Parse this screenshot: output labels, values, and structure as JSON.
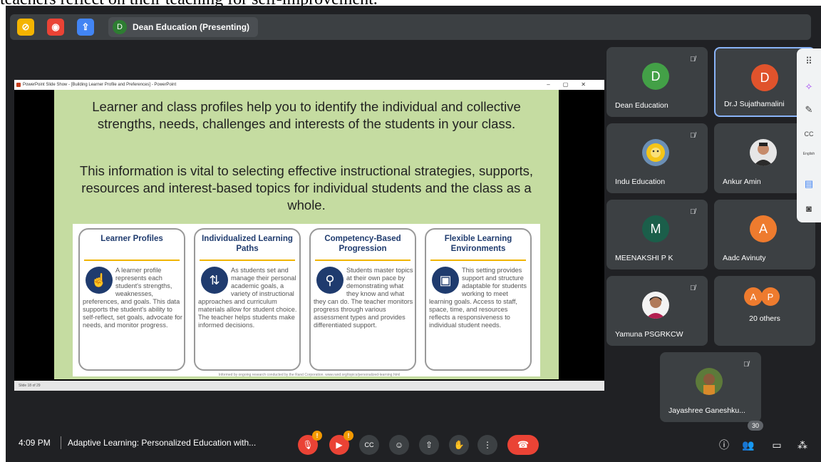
{
  "caption": "teachers reflect on their teaching for self-improvement.",
  "topbar": {
    "presenter_initial": "D",
    "presenting_label": "Dean Education (Presenting)",
    "icons": [
      "no-camera-icon",
      "record-icon",
      "share-icon"
    ],
    "colors": {
      "camera": "#f4b400",
      "record": "#ea4335",
      "share": "#4285f4"
    }
  },
  "slide": {
    "window_title": "PowerPoint Slide Show - [Building Learner Profile and Preferences] - PowerPoint",
    "paragraph1": "Learner and class profiles help you to identify the individual and collective strengths, needs, challenges and interests of the students in your class.",
    "paragraph2": "This information is vital to selecting effective instructional strategies, supports, resources and interest-based topics for individual students and the class as a whole.",
    "cards": [
      {
        "title": "Learner Profiles",
        "icon": "fingerprint-icon",
        "body": "A learner profile represents each student's strengths, weaknesses, preferences, and goals. This data supports the student's ability to self-reflect, set goals, advocate for needs, and monitor progress."
      },
      {
        "title": "Individualized Learning Paths",
        "icon": "paths-icon",
        "body": "As students set and manage their personal academic goals, a variety of instructional approaches and curriculum materials allow for student choice. The teacher helps students make informed decisions."
      },
      {
        "title": "Competency-Based Progression",
        "icon": "cyclist-icon",
        "body": "Students master topics at their own pace by demonstrating what they know and what they can do. The teacher monitors progress through various assessment types and provides differentiated support."
      },
      {
        "title": "Flexible Learning Environments",
        "icon": "classroom-icon",
        "body": "This setting provides support and structure adaptable for students working to meet learning goals. Access to staff, space, time, and resources reflects a responsiveness to individual student needs."
      }
    ],
    "footer": "Informed by ongoing research conducted by the Rand Corporation. www.rand.org/topics/personalized-learning.html",
    "status": "Slide 18 of 29"
  },
  "participants": [
    {
      "name": "Dean Education",
      "initial": "D",
      "color": "#43a047"
    },
    {
      "name": "Dr.J Sujathamalini",
      "initial": "D",
      "color": "#e0532c",
      "active": true
    },
    {
      "name": "Indu Education",
      "photo": "sunflower-photo"
    },
    {
      "name": "Ankur Amin",
      "photo": "person-photo"
    },
    {
      "name": "MEENAKSHI P K",
      "initial": "M",
      "color": "#1b5e4a"
    },
    {
      "name": "Aadc Avinuty",
      "initial": "A",
      "color": "#ee7b2e"
    },
    {
      "name": "Yamuna PSGRKCW",
      "photo": "person-photo"
    },
    {
      "name": "20 others",
      "initials": [
        "A",
        "P"
      ]
    },
    {
      "name": "Jayashree Ganeshku...",
      "photo": "child-photo"
    }
  ],
  "side_panel": {
    "caption_lang": "English"
  },
  "bottom": {
    "time": "4:09 PM",
    "meeting_title": "Adaptive Learning: Personalized Education with...",
    "people_count": "30"
  }
}
